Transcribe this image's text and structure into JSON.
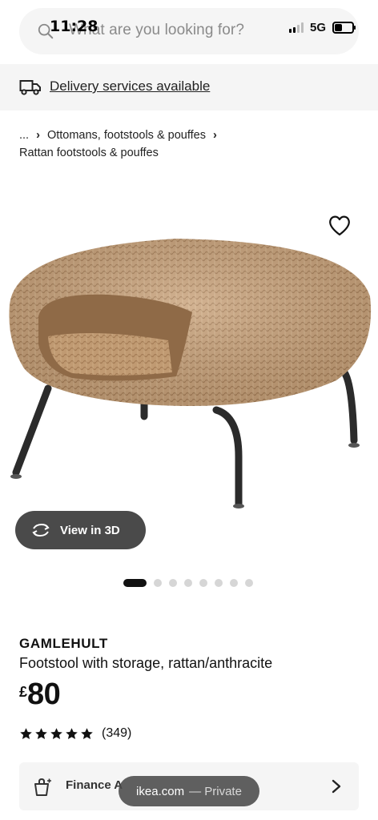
{
  "status_bar": {
    "time": "11:28",
    "network": "5G",
    "icons": [
      "signal-icon",
      "battery-icon"
    ]
  },
  "search": {
    "placeholder": "What are you looking for?",
    "icon": "search-icon"
  },
  "delivery": {
    "icon": "truck-icon",
    "link_text": "Delivery services available"
  },
  "breadcrumb": {
    "ellipsis": "...",
    "items": [
      "Ottomans, footstools & pouffes",
      "Rattan footstools & pouffes"
    ]
  },
  "product": {
    "image_alt": "rattan footstool with anthracite legs",
    "favorite_icon": "heart-icon",
    "view_3d_label": "View in 3D",
    "carousel": {
      "total": 8,
      "active_index": 0
    },
    "name": "GAMLEHULT",
    "description": "Footstool with storage, rattan/anthracite",
    "currency": "£",
    "price": "80",
    "rating": {
      "stars": 5,
      "count": "(349)"
    }
  },
  "finance": {
    "icon": "finance-bag-icon",
    "label": "Finance A"
  },
  "browser_pill": {
    "domain": "ikea.com",
    "mode": "— Private"
  },
  "colors": {
    "surface": "#f5f5f5",
    "rattan": "#c9a27a",
    "legs": "#2b2b2b",
    "pill": "#4a4a4a"
  }
}
